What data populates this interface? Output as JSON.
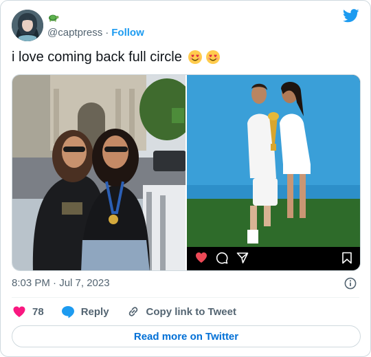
{
  "tweet": {
    "handle": "@captpress",
    "separator": "·",
    "follow_label": "Follow",
    "text": "i love coming back full circle",
    "emojis": [
      "smiling-face-with-heart-eyes-emoji",
      "smiling-face-with-heart-eyes-emoji"
    ],
    "timestamp": "8:03 PM · Jul 7, 2023"
  },
  "actions": {
    "like_count": "78",
    "reply_label": "Reply",
    "copy_label": "Copy link to Tweet"
  },
  "footer": {
    "read_more_label": "Read more on Twitter"
  },
  "icons": {
    "brand": "twitter-bird-icon",
    "badge": "turtle-icon",
    "info": "info-icon",
    "like": "heart-icon",
    "reply": "speech-bubble-icon",
    "copy": "link-icon",
    "ig_like": "heart-icon",
    "ig_comment": "comment-icon",
    "ig_share": "send-icon",
    "ig_save": "bookmark-icon"
  },
  "colors": {
    "accent": "#1d9bf0",
    "like": "#f91880",
    "link_text": "#006fd6",
    "muted": "#536471"
  }
}
